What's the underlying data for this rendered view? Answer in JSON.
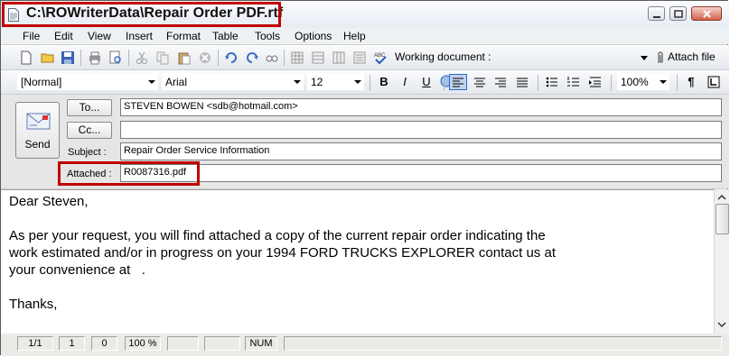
{
  "window": {
    "title": "C:\\ROWriterData\\Repair Order PDF.rtf"
  },
  "menu": [
    "File",
    "Edit",
    "View",
    "Insert",
    "Format",
    "Table",
    "Tools",
    "Options",
    "Help"
  ],
  "toolbar": {
    "working_label": "Working document :",
    "working_value": "",
    "attach_label": "Attach file"
  },
  "format_bar": {
    "style": "[Normal]",
    "font": "Arial",
    "size": "12",
    "zoom": "100%",
    "bold": "B",
    "italic": "I",
    "underline": "U",
    "paragraph": "¶",
    "alignment": "left"
  },
  "mail": {
    "send_label": "Send",
    "to_button": "To...",
    "cc_button": "Cc...",
    "to_value": "STEVEN BOWEN <sdb@hotmail.com>",
    "cc_value": "",
    "subject_label": "Subject :",
    "subject_value": "Repair Order Service Information",
    "attached_label": "Attached :",
    "attached_value": "R0087316.pdf"
  },
  "body": {
    "line1": "Dear Steven,",
    "line2": "",
    "line3": "As per your request, you will find attached a copy of the current repair order indicating the",
    "line4": "work estimated and/or in progress on your 1994 FORD TRUCKS EXPLORER contact us at",
    "line5": "your convenience at   .",
    "line6": "",
    "line7": "Thanks,"
  },
  "status": {
    "page": "1/1",
    "line": "1",
    "col": "0",
    "zoom": "100 %",
    "num": "NUM"
  },
  "colors": {
    "highlight": "#c00000",
    "active_button": "#c1d2ee"
  }
}
